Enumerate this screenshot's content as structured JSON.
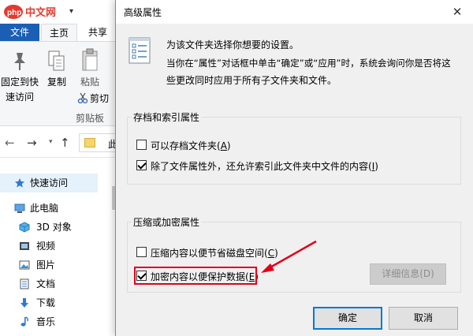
{
  "explorer": {
    "watermark_text": "php中文网",
    "tabs": {
      "file": "文件",
      "home": "主页",
      "share": "共享"
    },
    "ribbon": {
      "pin_label_line1": "固定到快",
      "pin_label_line2": "速访问",
      "copy_label": "复制",
      "paste_label": "粘贴",
      "cut_label": "剪切",
      "group_label": "剪贴板"
    },
    "address_text": "此",
    "nav": [
      {
        "label": "快速访问",
        "icon": "star-icon"
      },
      {
        "label": "此电脑",
        "icon": "computer-icon"
      },
      {
        "label": "3D 对象",
        "icon": "cube-icon"
      },
      {
        "label": "视频",
        "icon": "video-icon"
      },
      {
        "label": "图片",
        "icon": "picture-icon"
      },
      {
        "label": "文档",
        "icon": "document-icon"
      },
      {
        "label": "下载",
        "icon": "download-icon"
      },
      {
        "label": "音乐",
        "icon": "music-icon"
      }
    ]
  },
  "dialog": {
    "title": "高级属性",
    "intro_line1": "为该文件夹选择你想要的设置。",
    "intro_line2": "当你在“属性”对话框中单击“确定”或“应用”时，系统会询问你是否将这",
    "intro_line3": "些更改同时应用于所有子文件夹和文件。",
    "archive_group": {
      "title": "存档和索引属性",
      "archive": {
        "label": "可以存档文件夹",
        "mnemonic": "A",
        "checked": false
      },
      "index": {
        "label": "除了文件属性外，还允许索引此文件夹中文件的内容",
        "mnemonic": "I",
        "checked": true
      }
    },
    "compress_group": {
      "title": "压缩或加密属性",
      "compress": {
        "label": "压缩内容以便节省磁盘空间",
        "mnemonic": "C",
        "checked": false
      },
      "encrypt": {
        "label": "加密内容以便保护数据",
        "mnemonic": "E",
        "checked": true
      },
      "details_button": "详细信息(D)"
    },
    "ok_button": "确定",
    "cancel_button": "取消",
    "annotation_color": "#e0001b"
  }
}
